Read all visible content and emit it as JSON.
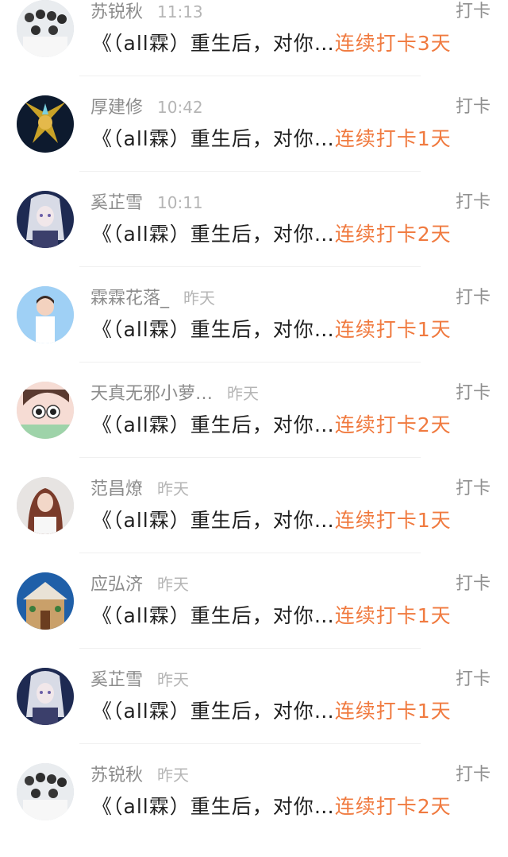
{
  "items": [
    {
      "name": "苏锐秋",
      "time": "11:13",
      "tag": "打卡",
      "book": "《（all霖）重生后，对你…",
      "streak": "连续打卡3天",
      "avatar": "group-photo-avatar"
    },
    {
      "name": "厚建修",
      "time": "10:42",
      "tag": "打卡",
      "book": "《（all霖）重生后，对你…",
      "streak": "连续打卡1天",
      "avatar": "fantasy-warrior-avatar"
    },
    {
      "name": "奚芷雪",
      "time": "10:11",
      "tag": "打卡",
      "book": "《（all霖）重生后，对你…",
      "streak": "连续打卡2天",
      "avatar": "anime-girl-avatar"
    },
    {
      "name": "霖霖花落_",
      "time": "昨天",
      "tag": "打卡",
      "book": "《（all霖）重生后，对你…",
      "streak": "连续打卡1天",
      "avatar": "singer-avatar"
    },
    {
      "name": "天真无邪小萝…",
      "time": "昨天",
      "tag": "打卡",
      "book": "《（all霖）重生后，对你…",
      "streak": "连续打卡2天",
      "avatar": "cartoon-face-avatar"
    },
    {
      "name": "范昌燎",
      "time": "昨天",
      "tag": "打卡",
      "book": "《（all霖）重生后，对你…",
      "streak": "连续打卡1天",
      "avatar": "woman-photo-avatar"
    },
    {
      "name": "应弘济",
      "time": "昨天",
      "tag": "打卡",
      "book": "《（all霖）重生后，对你…",
      "streak": "连续打卡1天",
      "avatar": "gingerbread-house-avatar"
    },
    {
      "name": "奚芷雪",
      "time": "昨天",
      "tag": "打卡",
      "book": "《（all霖）重生后，对你…",
      "streak": "连续打卡1天",
      "avatar": "anime-girl-avatar"
    },
    {
      "name": "苏锐秋",
      "time": "昨天",
      "tag": "打卡",
      "book": "《（all霖）重生后，对你…",
      "streak": "连续打卡2天",
      "avatar": "group-photo-avatar"
    }
  ],
  "colors": {
    "streak": "#f07a3f",
    "name": "#8c8c8c",
    "time": "#b5b5b5",
    "book": "#1f1f1f",
    "divider": "#f0f0f0"
  }
}
